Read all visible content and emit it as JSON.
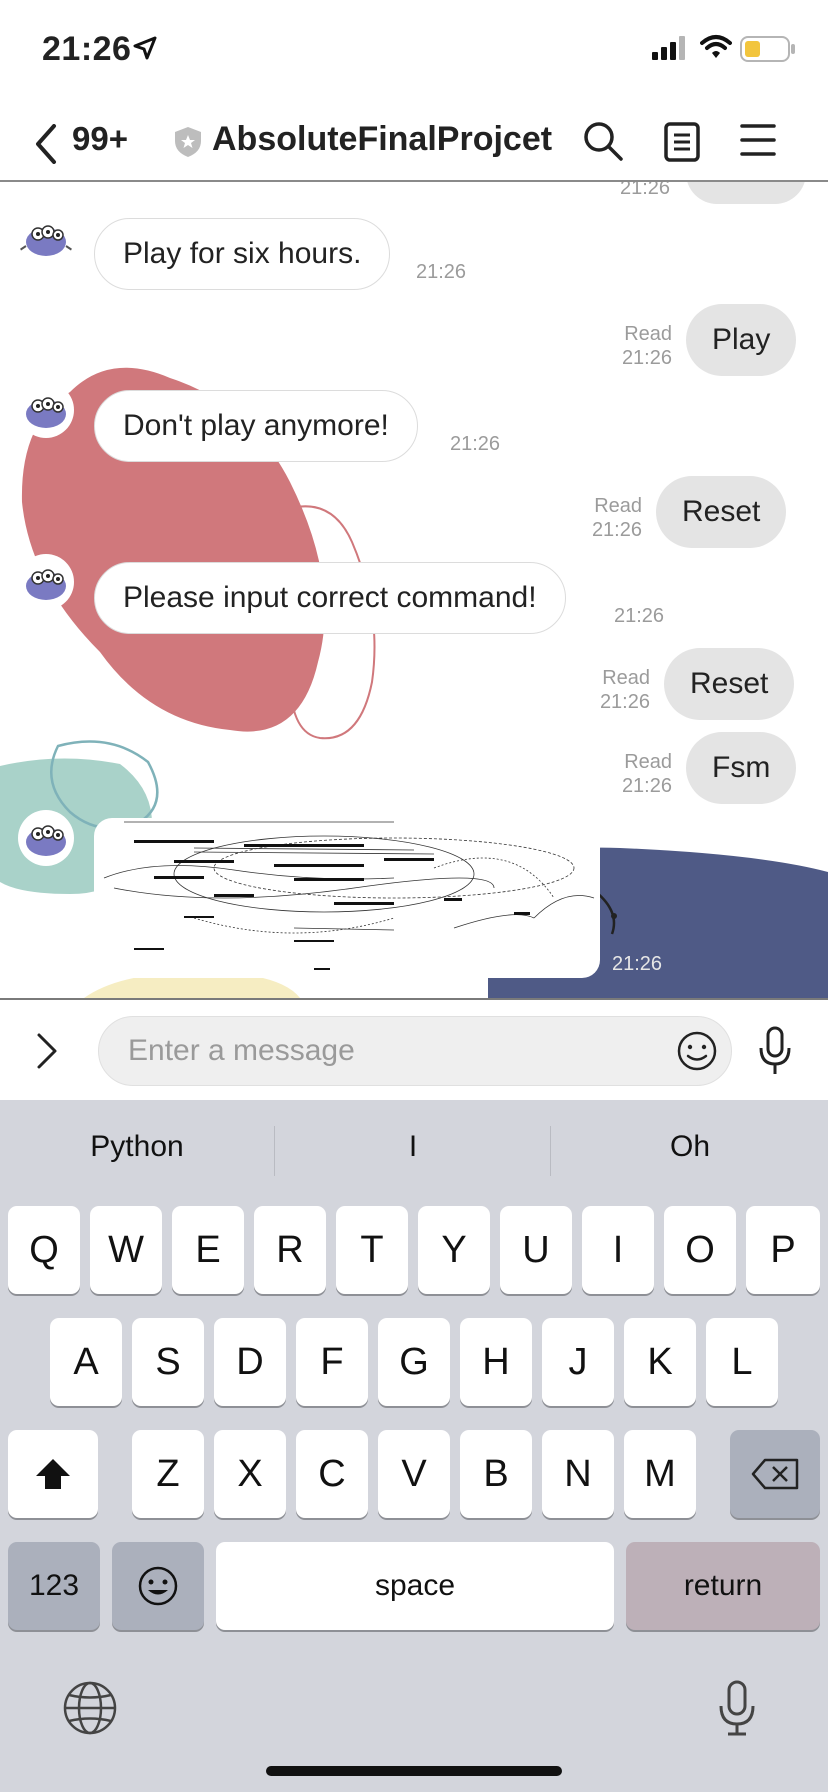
{
  "status_bar": {
    "time": "21:26"
  },
  "nav": {
    "unread": "99+",
    "title": "AbsoluteFinalProjcet"
  },
  "messages": [
    {
      "side": "in",
      "text": "Play for six hours.",
      "time": "21:26"
    },
    {
      "side": "out",
      "text": "Play",
      "read": "Read",
      "time": "21:26"
    },
    {
      "side": "in",
      "text": "Don't play anymore!",
      "time": "21:26"
    },
    {
      "side": "out",
      "text": "Reset",
      "read": "Read",
      "time": "21:26"
    },
    {
      "side": "in",
      "text": "Please input correct command!",
      "time": "21:26"
    },
    {
      "side": "out",
      "text": "Reset",
      "read": "Read",
      "time": "21:26"
    },
    {
      "side": "out",
      "text": "Fsm",
      "read": "Read",
      "time": "21:26"
    },
    {
      "side": "in",
      "type": "image",
      "time": "21:26"
    }
  ],
  "top_partial_time": "21:26",
  "input": {
    "placeholder": "Enter a message"
  },
  "keyboard": {
    "suggestions": [
      "Python",
      "I",
      "Oh"
    ],
    "row1": [
      "Q",
      "W",
      "E",
      "R",
      "T",
      "Y",
      "U",
      "I",
      "O",
      "P"
    ],
    "row2": [
      "A",
      "S",
      "D",
      "F",
      "G",
      "H",
      "J",
      "K",
      "L"
    ],
    "row3": [
      "Z",
      "X",
      "C",
      "V",
      "B",
      "N",
      "M"
    ],
    "numbers_label": "123",
    "space_label": "space",
    "return_label": "return"
  },
  "colors": {
    "deco_red": "#d0787c",
    "deco_teal": "#a9d2c9",
    "deco_navy": "#4f5a86",
    "deco_yellow": "#f6edc2",
    "outgoing_bubble": "#e4e4e4",
    "keyboard_bg": "#d3d5dc"
  },
  "icons": [
    "location-arrow-icon",
    "signal-icon",
    "wifi-icon",
    "battery-icon",
    "back-chevron-icon",
    "shield-icon",
    "search-icon",
    "notes-icon",
    "menu-icon",
    "expand-chevron-icon",
    "emoji-icon",
    "microphone-icon",
    "shift-icon",
    "backspace-icon",
    "globe-icon"
  ]
}
